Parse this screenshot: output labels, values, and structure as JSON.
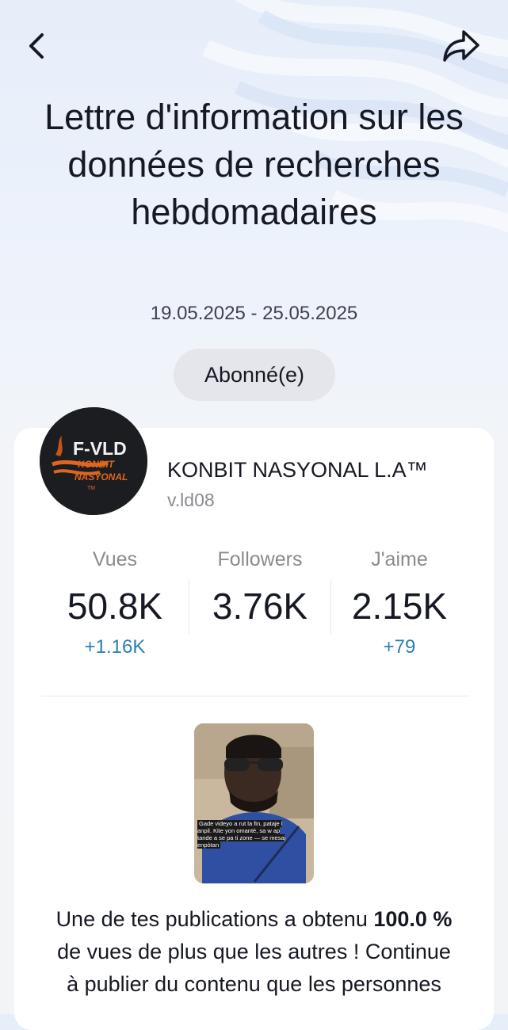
{
  "header": {
    "back_icon": "chevron-left-icon",
    "share_icon": "share-arrow-icon",
    "title": "Lettre d'information sur les données de recherches hebdomadaires",
    "date_range": "19.05.2025 - 25.05.2025",
    "subscribe_label": "Abonné(e)"
  },
  "account": {
    "avatar_logo_text": "F-VLD KONBIT NASYONAL TM",
    "name": "KONBIT NASYONAL L.A™",
    "handle": "v.ld08"
  },
  "stats": [
    {
      "label": "Vues",
      "value": "50.8K",
      "delta": "+1.16K"
    },
    {
      "label": "Followers",
      "value": "3.76K",
      "delta": ""
    },
    {
      "label": "J'aime",
      "value": "2.15K",
      "delta": "+79"
    }
  ],
  "top_post": {
    "caption": "Gade videyo a rut la fin, pataje l anpil. Kite yon omantè, sa w ap tande a se pa ti zone — se mesaj enpòtan"
  },
  "promo": {
    "text_before": "Une de tes publications a obtenu ",
    "highlight": "100.0 %",
    "text_after": " de vues de plus que les autres ! Continue à publier du contenu que les personnes"
  },
  "colors": {
    "accent_delta": "#2b7fb6",
    "text_primary": "#161823",
    "text_secondary": "#8a8b91"
  }
}
